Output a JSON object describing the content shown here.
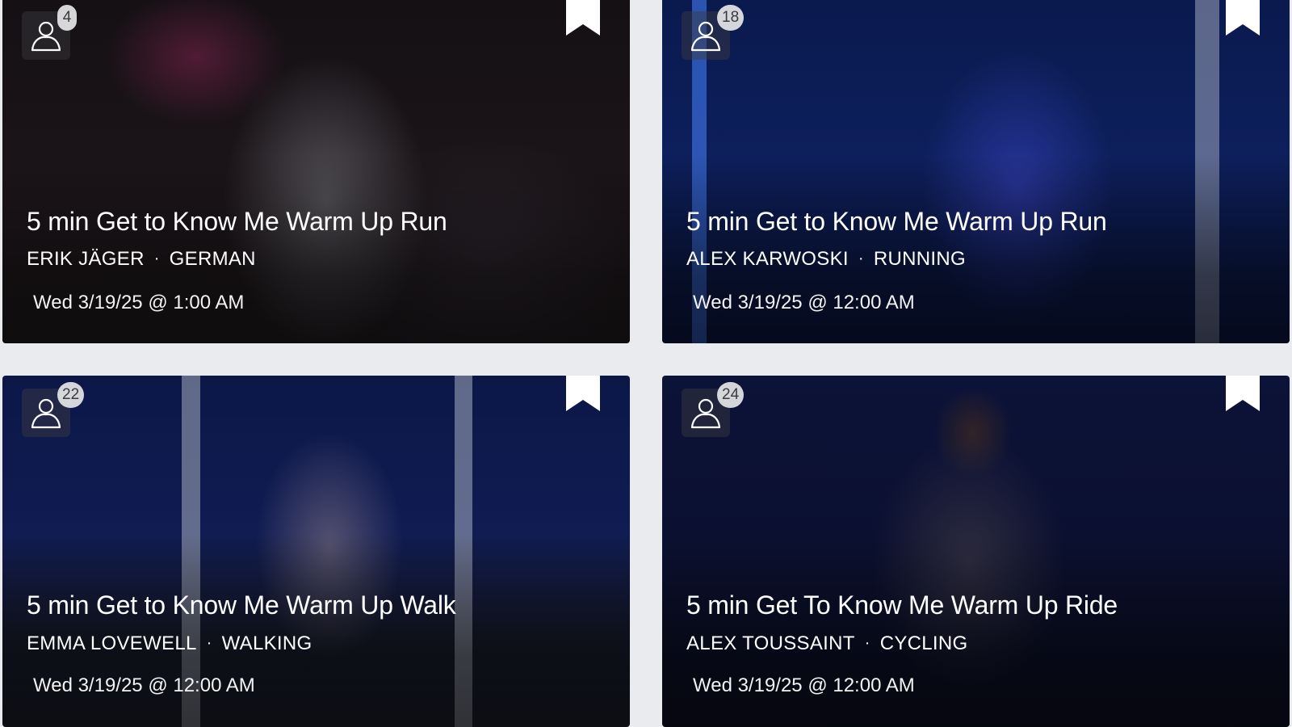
{
  "cards": [
    {
      "participants": "4",
      "title": "5 min Get to Know Me Warm Up Run",
      "instructor": "ERIK JÄGER",
      "category": "GERMAN",
      "separator": "·",
      "date": "Wed 3/19/25 @ 1:00 AM"
    },
    {
      "participants": "18",
      "title": "5 min Get to Know Me Warm Up Run",
      "instructor": "ALEX KARWOSKI",
      "category": "RUNNING",
      "separator": "·",
      "date": "Wed 3/19/25 @ 12:00 AM"
    },
    {
      "participants": "22",
      "title": "5 min Get to Know Me Warm Up Walk",
      "instructor": "EMMA LOVEWELL",
      "category": "WALKING",
      "separator": "·",
      "date": "Wed 3/19/25 @ 12:00 AM"
    },
    {
      "participants": "24",
      "title": "5 min Get To Know Me Warm Up Ride",
      "instructor": "ALEX TOUSSAINT",
      "category": "CYCLING",
      "separator": "·",
      "date": "Wed 3/19/25 @ 12:00 AM"
    }
  ],
  "icons": {
    "participants": "person-icon",
    "bookmark": "bookmark-icon"
  },
  "colors": {
    "page_background": "#e9ebee",
    "badge_background": "#e6e6e8",
    "text": "#ffffff"
  }
}
